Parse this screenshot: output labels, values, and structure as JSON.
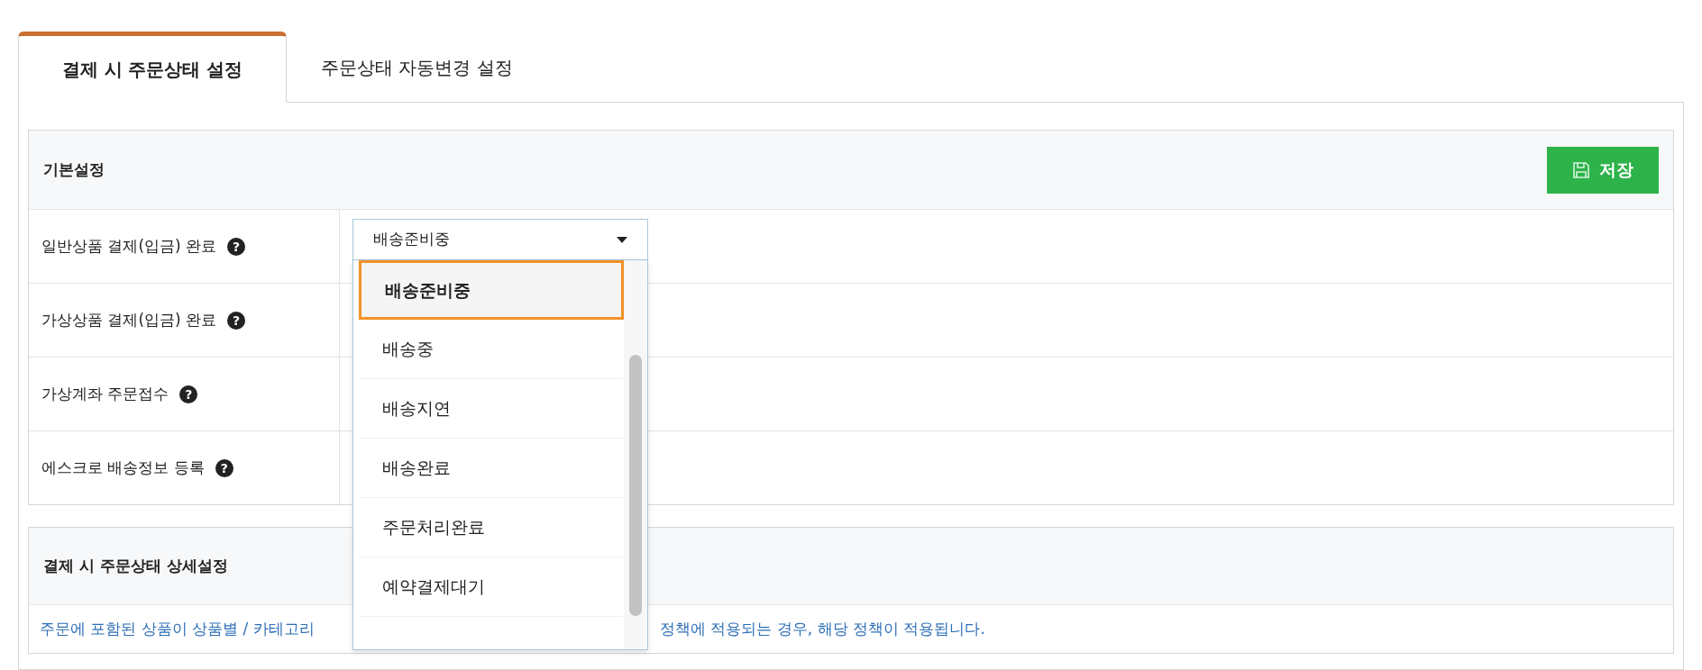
{
  "tabs": [
    {
      "label": "결제 시 주문상태 설정",
      "selected": true
    },
    {
      "label": "주문상태 자동변경 설정",
      "selected": false
    }
  ],
  "basic_panel": {
    "title": "기본설정",
    "save_button": "저장",
    "rows": [
      {
        "label": "일반상품 결제(입금) 완료",
        "help": "?",
        "value": "배송준비중",
        "expanded": true
      },
      {
        "label": "가상상품 결제(입금) 완료",
        "help": "?"
      },
      {
        "label": "가상계좌 주문접수",
        "help": "?"
      },
      {
        "label": "에스크로 배송정보 등록",
        "help": "?"
      }
    ]
  },
  "dropdown_options": [
    {
      "label": "배송준비중",
      "selected": true
    },
    {
      "label": "배송중",
      "selected": false
    },
    {
      "label": "배송지연",
      "selected": false
    },
    {
      "label": "배송완료",
      "selected": false
    },
    {
      "label": "주문처리완료",
      "selected": false
    },
    {
      "label": "예약결제대기",
      "selected": false
    }
  ],
  "detail_panel": {
    "title": "결제 시 주문상태 상세설정",
    "note_left": "주문에 포함된 상품이 상품별 / 카테고리",
    "note_right": "정책에 적용되는 경우, 해당 정책이 적용됩니다."
  }
}
